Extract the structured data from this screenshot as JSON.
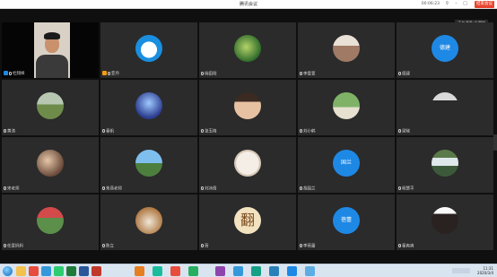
{
  "window": {
    "title": "腾讯会议",
    "time": "00:06:23",
    "end_label": "结束会议",
    "view_toggle": "正在讲话: 杜翔样"
  },
  "participants": [
    {
      "name": "杜翔样",
      "avatar": "video",
      "host": true
    },
    {
      "name": "亚丹",
      "avatar": "doraemon",
      "cohost": true
    },
    {
      "name": "杨田阳",
      "avatar": "leaves"
    },
    {
      "name": "李雯萱",
      "avatar": "girl"
    },
    {
      "name": "德建",
      "avatar": "text",
      "avatar_text": "德建"
    },
    {
      "name": "黄涛",
      "avatar": "landscape"
    },
    {
      "name": "秦帆",
      "avatar": "space"
    },
    {
      "name": "张玉梅",
      "avatar": "girl2"
    },
    {
      "name": "刘小鹤",
      "avatar": "tree"
    },
    {
      "name": "梁晓",
      "avatar": "man"
    },
    {
      "name": "宋老师",
      "avatar": "selfie"
    },
    {
      "name": "朱燕老师",
      "avatar": "sky"
    },
    {
      "name": "刘冰倩",
      "avatar": "dice"
    },
    {
      "name": "胡国兰",
      "avatar": "text",
      "avatar_text": "国兰"
    },
    {
      "name": "程慧平",
      "avatar": "waterfall"
    },
    {
      "name": "任爱妈妈",
      "avatar": "kids"
    },
    {
      "name": "陈立",
      "avatar": "dog"
    },
    {
      "name": "蓓",
      "avatar": "char",
      "avatar_char": "翻"
    },
    {
      "name": "李蓓蕾",
      "avatar": "text",
      "avatar_text": "蓓蕾"
    },
    {
      "name": "秦爽爽",
      "avatar": "woman"
    }
  ],
  "taskbar": {
    "clock_time": "11:31",
    "clock_date": "2020/3/4"
  },
  "colors": {
    "accent_blue": "#1e88e5",
    "end_red": "#e8452f",
    "tile_bg": "#2b2b2b"
  }
}
